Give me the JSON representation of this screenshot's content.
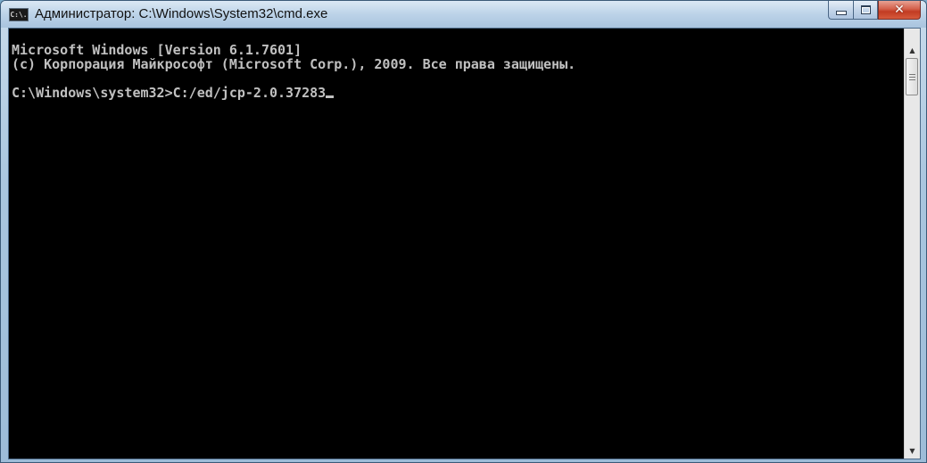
{
  "window": {
    "title": "Администратор: C:\\Windows\\System32\\cmd.exe",
    "icon_label": "C:\\."
  },
  "controls": {
    "minimize": "minimize-icon",
    "maximize": "maximize-icon",
    "close": "close-icon"
  },
  "console": {
    "lines": [
      "Microsoft Windows [Version 6.1.7601]",
      "(c) Корпорация Майкрософт (Microsoft Corp.), 2009. Все права защищены.",
      "",
      "C:\\Windows\\system32>C:/ed/jcp-2.0.37283"
    ],
    "text_color": "#c0c0c0",
    "background_color": "#000000"
  },
  "scrollbar": {
    "up_arrow": "▲",
    "down_arrow": "▼"
  }
}
